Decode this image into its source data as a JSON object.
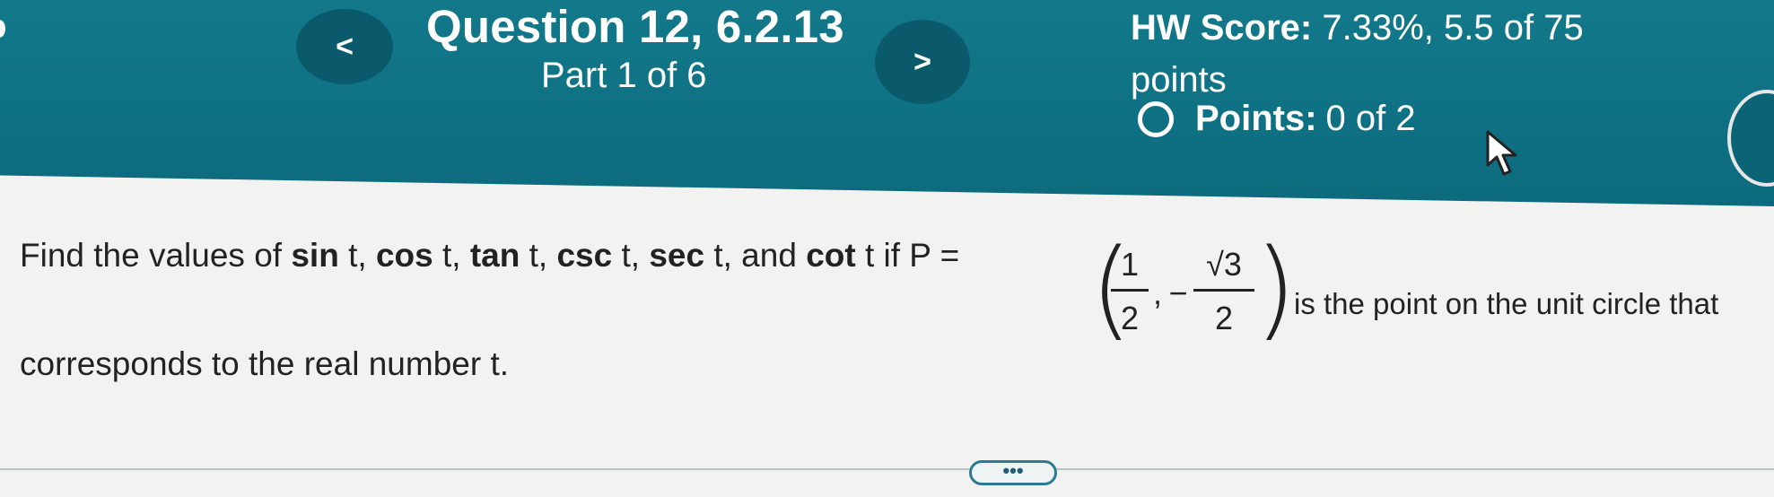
{
  "header": {
    "question_title": "Question 12, 6.2.13",
    "part_label": "Part 1 of 6",
    "prev_label": "<",
    "next_label": ">",
    "hw_score_label": "HW Score:",
    "hw_score_value": "7.33%, 5.5 of 75 points",
    "points_label": "Points:",
    "points_value": "0 of 2",
    "accent_color": "#0f7184"
  },
  "question": {
    "find": "Find the values of",
    "f1": "sin",
    "f2": "cos",
    "f3": "tan",
    "f4": "csc",
    "f5": "sec",
    "f6": "cot",
    "var": "t",
    "and": "and",
    "if_p": "if P =",
    "x_num": "1",
    "x_den": "2",
    "y_sign": "−",
    "y_num": "√3",
    "y_den": "2",
    "tail": "is the point on the unit circle that",
    "line2": "corresponds to the real number t."
  },
  "footer": {
    "more_label": "•••"
  }
}
